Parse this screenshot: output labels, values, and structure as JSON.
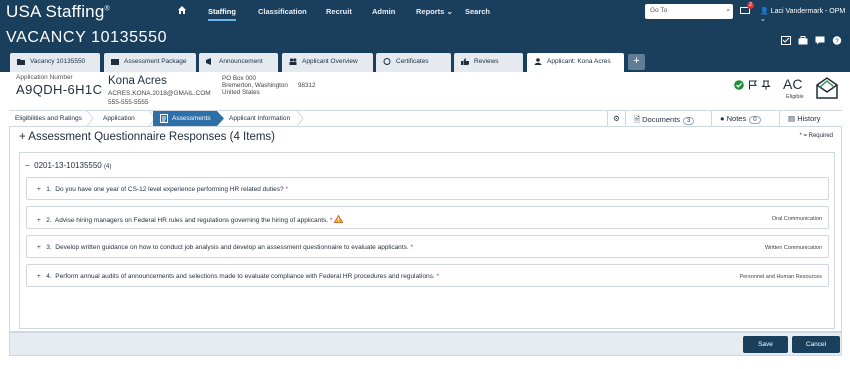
{
  "brand": {
    "name": "USA Staffing",
    "mark": "®"
  },
  "nav": {
    "items": [
      "Staffing",
      "Classification",
      "Recruit",
      "Admin",
      "Reports",
      "Search"
    ],
    "active": "Staffing"
  },
  "goto": {
    "placeholder": "Go To"
  },
  "mail": {
    "count": "2"
  },
  "user": {
    "name": "Laci Vandermark - OPM"
  },
  "vacancy": {
    "title": "VACANCY 10135550"
  },
  "tabs": [
    {
      "label": "Vacancy 10135550",
      "icon": "folder-icon"
    },
    {
      "label": "Assessment Package",
      "icon": "package-icon"
    },
    {
      "label": "Announcement",
      "icon": "megaphone-icon"
    },
    {
      "label": "Applicant Overview",
      "icon": "people-icon"
    },
    {
      "label": "Certificates",
      "icon": "certificate-icon"
    },
    {
      "label": "Reviews",
      "icon": "thumbs-up-icon"
    },
    {
      "label": "Applicant: Kona Acres",
      "icon": "person-icon"
    }
  ],
  "applicant": {
    "number_label": "Application Number",
    "number": "A9QDH-6H1C",
    "name": "Kona Acres",
    "email": "ACRES.KONA.2018@GMAIL.COM",
    "phone": "555-555-5555",
    "address": [
      "PO Box 000",
      "Bremerton, Washington",
      "98312",
      "United States"
    ],
    "initials": "AC",
    "status": "Eligible"
  },
  "steps": [
    "Eligibilities and Ratings",
    "Application",
    "Assessments",
    "Applicant Information"
  ],
  "tools": {
    "documents_label": "Documents",
    "documents_count": "3",
    "notes_label": "Notes",
    "notes_count": "0",
    "history_label": "History"
  },
  "section": {
    "title": "Assessment Questionnaire Responses (4 Items)",
    "required_note": "* = Required",
    "group_title": "0201-13-10135550",
    "group_count": "(4)"
  },
  "questions": [
    {
      "num": "1.",
      "text": "Do you have one year of CS-12 level experience performing HR related duties?",
      "competency": "",
      "warning": false
    },
    {
      "num": "2.",
      "text": "Advise hiring managers on Federal HR rules and regulations governing the hiring of applicants.",
      "competency": "Oral Communication",
      "warning": true
    },
    {
      "num": "3.",
      "text": "Develop written guidance on how to conduct job analysis and develop an assessment questionnaire to evaluate applicants.",
      "competency": "Written Communication",
      "warning": false
    },
    {
      "num": "4.",
      "text": "Perform annual audits of announcements and selections made to evaluate compliance with Federal HR procedures and regulations.",
      "competency": "Personnel and Human Resources",
      "warning": false
    }
  ],
  "buttons": {
    "save": "Save",
    "cancel": "Cancel"
  }
}
